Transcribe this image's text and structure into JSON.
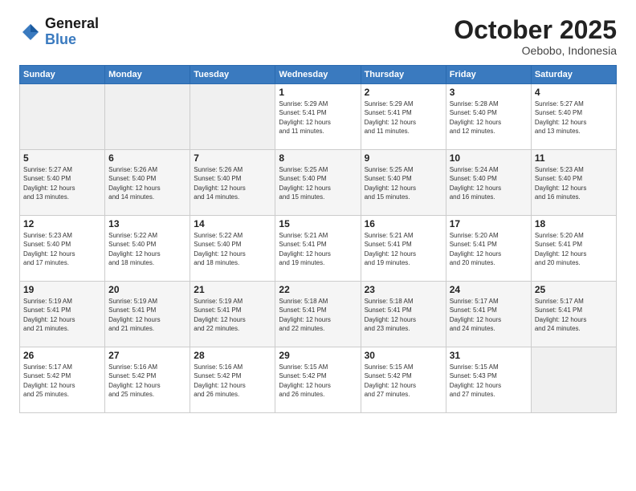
{
  "header": {
    "logo_general": "General",
    "logo_blue": "Blue",
    "month": "October 2025",
    "location": "Oebobo, Indonesia"
  },
  "weekdays": [
    "Sunday",
    "Monday",
    "Tuesday",
    "Wednesday",
    "Thursday",
    "Friday",
    "Saturday"
  ],
  "weeks": [
    [
      {
        "day": "",
        "info": ""
      },
      {
        "day": "",
        "info": ""
      },
      {
        "day": "",
        "info": ""
      },
      {
        "day": "1",
        "info": "Sunrise: 5:29 AM\nSunset: 5:41 PM\nDaylight: 12 hours\nand 11 minutes."
      },
      {
        "day": "2",
        "info": "Sunrise: 5:29 AM\nSunset: 5:41 PM\nDaylight: 12 hours\nand 11 minutes."
      },
      {
        "day": "3",
        "info": "Sunrise: 5:28 AM\nSunset: 5:40 PM\nDaylight: 12 hours\nand 12 minutes."
      },
      {
        "day": "4",
        "info": "Sunrise: 5:27 AM\nSunset: 5:40 PM\nDaylight: 12 hours\nand 13 minutes."
      }
    ],
    [
      {
        "day": "5",
        "info": "Sunrise: 5:27 AM\nSunset: 5:40 PM\nDaylight: 12 hours\nand 13 minutes."
      },
      {
        "day": "6",
        "info": "Sunrise: 5:26 AM\nSunset: 5:40 PM\nDaylight: 12 hours\nand 14 minutes."
      },
      {
        "day": "7",
        "info": "Sunrise: 5:26 AM\nSunset: 5:40 PM\nDaylight: 12 hours\nand 14 minutes."
      },
      {
        "day": "8",
        "info": "Sunrise: 5:25 AM\nSunset: 5:40 PM\nDaylight: 12 hours\nand 15 minutes."
      },
      {
        "day": "9",
        "info": "Sunrise: 5:25 AM\nSunset: 5:40 PM\nDaylight: 12 hours\nand 15 minutes."
      },
      {
        "day": "10",
        "info": "Sunrise: 5:24 AM\nSunset: 5:40 PM\nDaylight: 12 hours\nand 16 minutes."
      },
      {
        "day": "11",
        "info": "Sunrise: 5:23 AM\nSunset: 5:40 PM\nDaylight: 12 hours\nand 16 minutes."
      }
    ],
    [
      {
        "day": "12",
        "info": "Sunrise: 5:23 AM\nSunset: 5:40 PM\nDaylight: 12 hours\nand 17 minutes."
      },
      {
        "day": "13",
        "info": "Sunrise: 5:22 AM\nSunset: 5:40 PM\nDaylight: 12 hours\nand 18 minutes."
      },
      {
        "day": "14",
        "info": "Sunrise: 5:22 AM\nSunset: 5:40 PM\nDaylight: 12 hours\nand 18 minutes."
      },
      {
        "day": "15",
        "info": "Sunrise: 5:21 AM\nSunset: 5:41 PM\nDaylight: 12 hours\nand 19 minutes."
      },
      {
        "day": "16",
        "info": "Sunrise: 5:21 AM\nSunset: 5:41 PM\nDaylight: 12 hours\nand 19 minutes."
      },
      {
        "day": "17",
        "info": "Sunrise: 5:20 AM\nSunset: 5:41 PM\nDaylight: 12 hours\nand 20 minutes."
      },
      {
        "day": "18",
        "info": "Sunrise: 5:20 AM\nSunset: 5:41 PM\nDaylight: 12 hours\nand 20 minutes."
      }
    ],
    [
      {
        "day": "19",
        "info": "Sunrise: 5:19 AM\nSunset: 5:41 PM\nDaylight: 12 hours\nand 21 minutes."
      },
      {
        "day": "20",
        "info": "Sunrise: 5:19 AM\nSunset: 5:41 PM\nDaylight: 12 hours\nand 21 minutes."
      },
      {
        "day": "21",
        "info": "Sunrise: 5:19 AM\nSunset: 5:41 PM\nDaylight: 12 hours\nand 22 minutes."
      },
      {
        "day": "22",
        "info": "Sunrise: 5:18 AM\nSunset: 5:41 PM\nDaylight: 12 hours\nand 22 minutes."
      },
      {
        "day": "23",
        "info": "Sunrise: 5:18 AM\nSunset: 5:41 PM\nDaylight: 12 hours\nand 23 minutes."
      },
      {
        "day": "24",
        "info": "Sunrise: 5:17 AM\nSunset: 5:41 PM\nDaylight: 12 hours\nand 24 minutes."
      },
      {
        "day": "25",
        "info": "Sunrise: 5:17 AM\nSunset: 5:41 PM\nDaylight: 12 hours\nand 24 minutes."
      }
    ],
    [
      {
        "day": "26",
        "info": "Sunrise: 5:17 AM\nSunset: 5:42 PM\nDaylight: 12 hours\nand 25 minutes."
      },
      {
        "day": "27",
        "info": "Sunrise: 5:16 AM\nSunset: 5:42 PM\nDaylight: 12 hours\nand 25 minutes."
      },
      {
        "day": "28",
        "info": "Sunrise: 5:16 AM\nSunset: 5:42 PM\nDaylight: 12 hours\nand 26 minutes."
      },
      {
        "day": "29",
        "info": "Sunrise: 5:15 AM\nSunset: 5:42 PM\nDaylight: 12 hours\nand 26 minutes."
      },
      {
        "day": "30",
        "info": "Sunrise: 5:15 AM\nSunset: 5:42 PM\nDaylight: 12 hours\nand 27 minutes."
      },
      {
        "day": "31",
        "info": "Sunrise: 5:15 AM\nSunset: 5:43 PM\nDaylight: 12 hours\nand 27 minutes."
      },
      {
        "day": "",
        "info": ""
      }
    ]
  ]
}
